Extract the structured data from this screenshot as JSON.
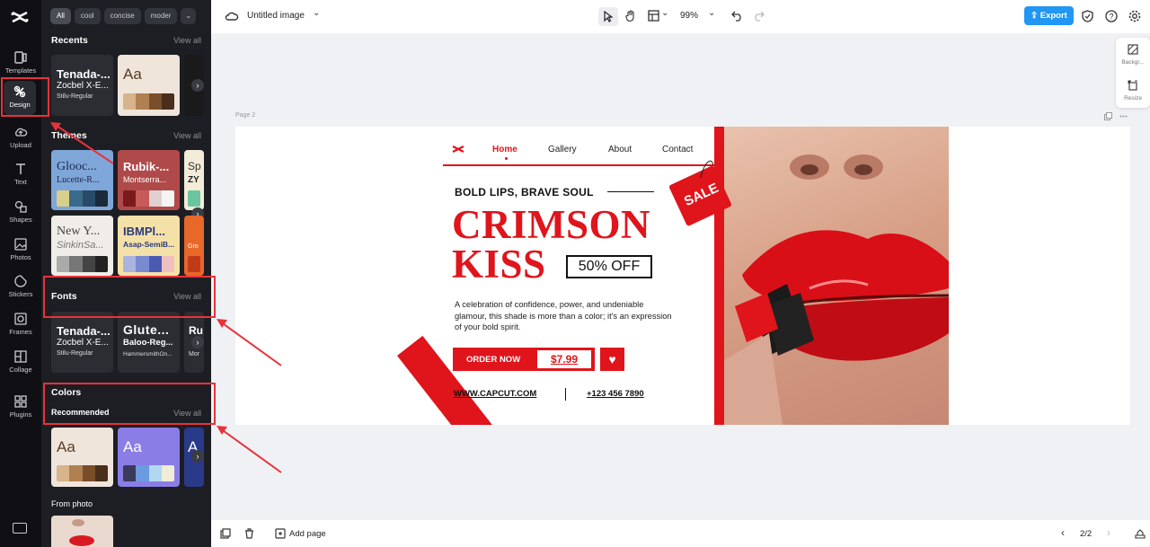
{
  "rail": {
    "items": [
      {
        "label": "Templates",
        "icon": "templates-icon"
      },
      {
        "label": "Design",
        "icon": "design-icon"
      },
      {
        "label": "Upload",
        "icon": "upload-icon"
      },
      {
        "label": "Text",
        "icon": "text-icon"
      },
      {
        "label": "Shapes",
        "icon": "shapes-icon"
      },
      {
        "label": "Photos",
        "icon": "photos-icon"
      },
      {
        "label": "Stickers",
        "icon": "stickers-icon"
      },
      {
        "label": "Frames",
        "icon": "frames-icon"
      },
      {
        "label": "Collage",
        "icon": "collage-icon"
      },
      {
        "label": "Plugins",
        "icon": "plugins-icon"
      }
    ]
  },
  "panel": {
    "chips": [
      "All",
      "cool",
      "concise",
      "moder"
    ],
    "view_all": "View all",
    "recents": {
      "title": "Recents",
      "font_card": {
        "t1": "Tenada-...",
        "t2": "Zocbel X-E...",
        "t3": "Stilu-Regular"
      },
      "color_card": {
        "t1": "Aa"
      }
    },
    "themes": {
      "title": "Themes",
      "cards": [
        {
          "t1": "Glooc...",
          "t2": "Lucette-R..."
        },
        {
          "t1": "Rubik-...",
          "t2": "Montserra..."
        },
        {
          "t1": "Sp",
          "t2": "ZY"
        },
        {
          "t1": "New Y...",
          "t2": "SinkinSa..."
        },
        {
          "t1": "IBMPl...",
          "t2": "Asap-SemiB..."
        },
        {
          "t1": "",
          "t2": "Gro"
        }
      ]
    },
    "fonts": {
      "title": "Fonts",
      "cards": [
        {
          "t1": "Tenada-...",
          "t2": "Zocbel X-E...",
          "t3": "Stilu-Regular"
        },
        {
          "t1": "Glute...",
          "t2": "Baloo-Reg...",
          "t3": "HammersmithOn..."
        },
        {
          "t1": "Ru",
          "t2": "",
          "t3": "Mor"
        }
      ]
    },
    "colors": {
      "title": "Colors",
      "subtitle": "Recommended",
      "cards": [
        {
          "t1": "Aa"
        },
        {
          "t1": "Aa"
        },
        {
          "t1": "A"
        }
      ]
    },
    "from_photo": "From photo"
  },
  "topbar": {
    "doc_title": "Untitled image",
    "zoom": "99%",
    "export": "Export"
  },
  "side_float": {
    "background": "Backgr...",
    "resize": "Resize"
  },
  "page_label": "Page 2",
  "design": {
    "nav": [
      "Home",
      "Gallery",
      "About",
      "Contact"
    ],
    "kicker": "BOLD LIPS, BRAVE SOUL",
    "headline1": "CRIMSON",
    "headline2": "KISS",
    "offer": "50% OFF",
    "sale": "SALE",
    "body": "A celebration of confidence, power, and undeniable glamour, this shade is more than a color; it's an expression of your bold spirit.",
    "order": "ORDER NOW",
    "price": "$7.99",
    "website": "WWW.CAPCUT.COM",
    "phone": "+123 456 7890"
  },
  "bottombar": {
    "add_page": "Add page",
    "pager": "2/2"
  },
  "colors": {
    "accent": "#e0141b",
    "export": "#2196f3",
    "rail": "#101014",
    "panel": "#1d1e23"
  }
}
